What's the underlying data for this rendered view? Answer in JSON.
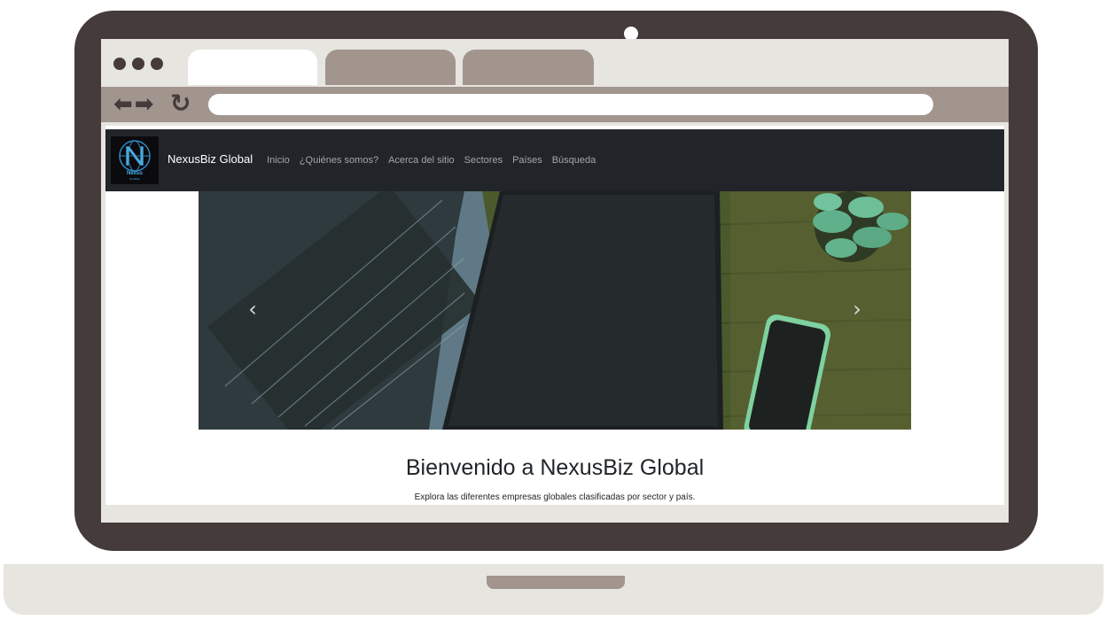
{
  "site": {
    "brand": "NexusBiz Global",
    "logo": {
      "letter": "N",
      "name": "Nexus",
      "subtitle": "GLOBAL"
    },
    "nav": [
      "Inicio",
      "¿Quiénes somos?",
      "Acerca del sitio",
      "Sectores",
      "Países",
      "Búsqueda"
    ]
  },
  "carousel": {
    "prev_icon": "‹",
    "next_icon": "›"
  },
  "welcome": {
    "title": "Bienvenido a NexusBiz Global",
    "subtitle": "Explora las diferentes empresas globales clasificadas por sector y país."
  },
  "browser": {
    "url": ""
  },
  "colors": {
    "bezel": "#453b3b",
    "chrome_accent": "#a1958d",
    "chrome_light": "#e6e5e0",
    "navbar": "#212529",
    "logo_blue": "#4aa8e0"
  }
}
